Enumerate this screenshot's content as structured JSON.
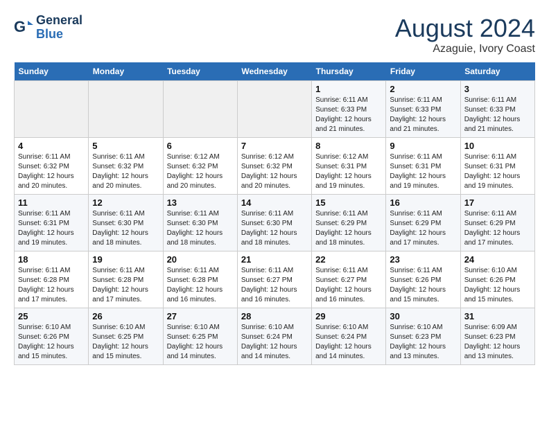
{
  "header": {
    "logo_line1": "General",
    "logo_line2": "Blue",
    "month_year": "August 2024",
    "location": "Azaguie, Ivory Coast"
  },
  "weekdays": [
    "Sunday",
    "Monday",
    "Tuesday",
    "Wednesday",
    "Thursday",
    "Friday",
    "Saturday"
  ],
  "weeks": [
    [
      {
        "day": "",
        "info": ""
      },
      {
        "day": "",
        "info": ""
      },
      {
        "day": "",
        "info": ""
      },
      {
        "day": "",
        "info": ""
      },
      {
        "day": "1",
        "info": "Sunrise: 6:11 AM\nSunset: 6:33 PM\nDaylight: 12 hours\nand 21 minutes."
      },
      {
        "day": "2",
        "info": "Sunrise: 6:11 AM\nSunset: 6:33 PM\nDaylight: 12 hours\nand 21 minutes."
      },
      {
        "day": "3",
        "info": "Sunrise: 6:11 AM\nSunset: 6:33 PM\nDaylight: 12 hours\nand 21 minutes."
      }
    ],
    [
      {
        "day": "4",
        "info": "Sunrise: 6:11 AM\nSunset: 6:32 PM\nDaylight: 12 hours\nand 20 minutes."
      },
      {
        "day": "5",
        "info": "Sunrise: 6:11 AM\nSunset: 6:32 PM\nDaylight: 12 hours\nand 20 minutes."
      },
      {
        "day": "6",
        "info": "Sunrise: 6:12 AM\nSunset: 6:32 PM\nDaylight: 12 hours\nand 20 minutes."
      },
      {
        "day": "7",
        "info": "Sunrise: 6:12 AM\nSunset: 6:32 PM\nDaylight: 12 hours\nand 20 minutes."
      },
      {
        "day": "8",
        "info": "Sunrise: 6:12 AM\nSunset: 6:31 PM\nDaylight: 12 hours\nand 19 minutes."
      },
      {
        "day": "9",
        "info": "Sunrise: 6:11 AM\nSunset: 6:31 PM\nDaylight: 12 hours\nand 19 minutes."
      },
      {
        "day": "10",
        "info": "Sunrise: 6:11 AM\nSunset: 6:31 PM\nDaylight: 12 hours\nand 19 minutes."
      }
    ],
    [
      {
        "day": "11",
        "info": "Sunrise: 6:11 AM\nSunset: 6:31 PM\nDaylight: 12 hours\nand 19 minutes."
      },
      {
        "day": "12",
        "info": "Sunrise: 6:11 AM\nSunset: 6:30 PM\nDaylight: 12 hours\nand 18 minutes."
      },
      {
        "day": "13",
        "info": "Sunrise: 6:11 AM\nSunset: 6:30 PM\nDaylight: 12 hours\nand 18 minutes."
      },
      {
        "day": "14",
        "info": "Sunrise: 6:11 AM\nSunset: 6:30 PM\nDaylight: 12 hours\nand 18 minutes."
      },
      {
        "day": "15",
        "info": "Sunrise: 6:11 AM\nSunset: 6:29 PM\nDaylight: 12 hours\nand 18 minutes."
      },
      {
        "day": "16",
        "info": "Sunrise: 6:11 AM\nSunset: 6:29 PM\nDaylight: 12 hours\nand 17 minutes."
      },
      {
        "day": "17",
        "info": "Sunrise: 6:11 AM\nSunset: 6:29 PM\nDaylight: 12 hours\nand 17 minutes."
      }
    ],
    [
      {
        "day": "18",
        "info": "Sunrise: 6:11 AM\nSunset: 6:28 PM\nDaylight: 12 hours\nand 17 minutes."
      },
      {
        "day": "19",
        "info": "Sunrise: 6:11 AM\nSunset: 6:28 PM\nDaylight: 12 hours\nand 17 minutes."
      },
      {
        "day": "20",
        "info": "Sunrise: 6:11 AM\nSunset: 6:28 PM\nDaylight: 12 hours\nand 16 minutes."
      },
      {
        "day": "21",
        "info": "Sunrise: 6:11 AM\nSunset: 6:27 PM\nDaylight: 12 hours\nand 16 minutes."
      },
      {
        "day": "22",
        "info": "Sunrise: 6:11 AM\nSunset: 6:27 PM\nDaylight: 12 hours\nand 16 minutes."
      },
      {
        "day": "23",
        "info": "Sunrise: 6:11 AM\nSunset: 6:26 PM\nDaylight: 12 hours\nand 15 minutes."
      },
      {
        "day": "24",
        "info": "Sunrise: 6:10 AM\nSunset: 6:26 PM\nDaylight: 12 hours\nand 15 minutes."
      }
    ],
    [
      {
        "day": "25",
        "info": "Sunrise: 6:10 AM\nSunset: 6:26 PM\nDaylight: 12 hours\nand 15 minutes."
      },
      {
        "day": "26",
        "info": "Sunrise: 6:10 AM\nSunset: 6:25 PM\nDaylight: 12 hours\nand 15 minutes."
      },
      {
        "day": "27",
        "info": "Sunrise: 6:10 AM\nSunset: 6:25 PM\nDaylight: 12 hours\nand 14 minutes."
      },
      {
        "day": "28",
        "info": "Sunrise: 6:10 AM\nSunset: 6:24 PM\nDaylight: 12 hours\nand 14 minutes."
      },
      {
        "day": "29",
        "info": "Sunrise: 6:10 AM\nSunset: 6:24 PM\nDaylight: 12 hours\nand 14 minutes."
      },
      {
        "day": "30",
        "info": "Sunrise: 6:10 AM\nSunset: 6:23 PM\nDaylight: 12 hours\nand 13 minutes."
      },
      {
        "day": "31",
        "info": "Sunrise: 6:09 AM\nSunset: 6:23 PM\nDaylight: 12 hours\nand 13 minutes."
      }
    ]
  ]
}
